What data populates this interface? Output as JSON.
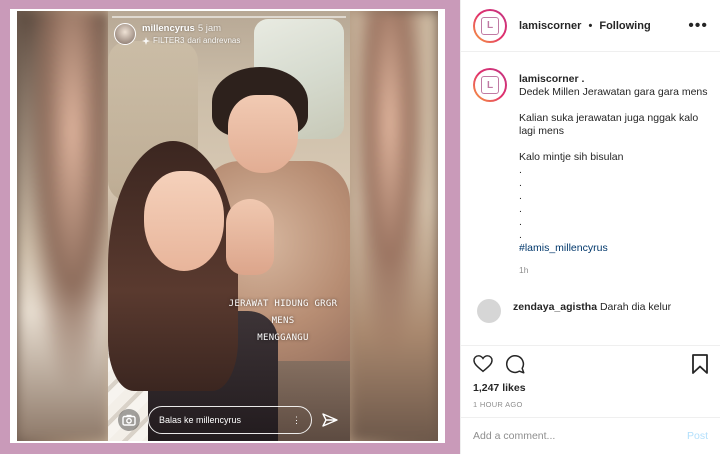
{
  "story": {
    "username": "millencyrus",
    "time": "5 jam",
    "filter_name": "FILTER3",
    "filter_by": "dari andrevnas",
    "caption_line1": "JERAWAT HIDUNG GRGR MENS",
    "caption_line2": "MENGGANGU",
    "reply_placeholder": "Balas ke millencyrus"
  },
  "header": {
    "username": "lamiscorner",
    "separator": "•",
    "follow_status": "Following",
    "more_label": "•••"
  },
  "caption": {
    "username": "lamiscorner .",
    "lines": [
      "Dedek Millen Jerawatan gara gara mens",
      "",
      "Kalian suka jerawatan juga nggak kalo lagi mens",
      "",
      "Kalo mintje sih bisulan",
      ".",
      ".",
      ".",
      ".",
      ".",
      "."
    ],
    "hashtag": "#lamis_millencyrus",
    "time": "1h"
  },
  "comment": {
    "username": "zendaya_agistha",
    "text": "Darah dia kelur"
  },
  "actions": {
    "likes": "1,247 likes",
    "posted_ago": "1 HOUR AGO"
  },
  "add_comment": {
    "placeholder": "Add a comment...",
    "post_label": "Post"
  },
  "colors": {
    "background": "#cf9fbf",
    "link": "#00376b",
    "post_disabled": "#b2dffc"
  }
}
